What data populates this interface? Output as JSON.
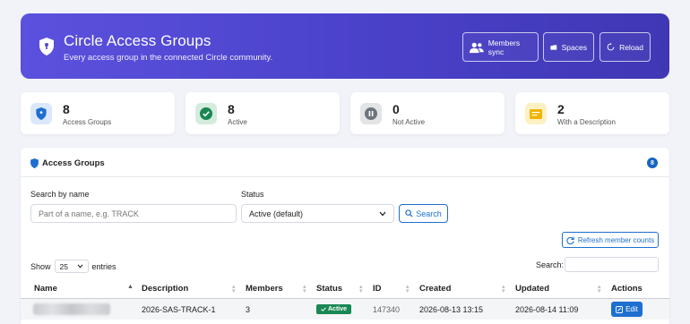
{
  "header": {
    "title": "Circle Access Groups",
    "subtitle": "Every access group in the connected Circle community.",
    "buttons": {
      "members_sync": "Members sync",
      "spaces": "Spaces",
      "reload": "Reload"
    }
  },
  "stats": [
    {
      "value": "8",
      "label": "Access Groups",
      "icon": "shield-icon",
      "color": "#1e6fd0"
    },
    {
      "value": "8",
      "label": "Active",
      "icon": "check-circle-icon",
      "color": "#198754"
    },
    {
      "value": "0",
      "label": "Not Active",
      "icon": "pause-circle-icon",
      "color": "#6c757d"
    },
    {
      "value": "2",
      "label": "With a Description",
      "icon": "description-icon",
      "color": "#f0b400"
    }
  ],
  "panel": {
    "title": "Access Groups",
    "count": "8",
    "search_label": "Search by name",
    "search_placeholder": "Part of a name, e.g. TRACK",
    "status_label": "Status",
    "status_value": "Active (default)",
    "search_button": "Search",
    "refresh_button": "Refresh member counts",
    "show_label": "Show",
    "entries_value": "25",
    "entries_label": "entries",
    "table_search_label": "Search:"
  },
  "table": {
    "columns": [
      "Name",
      "Description",
      "Members",
      "Status",
      "ID",
      "Created",
      "Updated",
      "Actions"
    ],
    "rows": [
      {
        "description": "2026-SAS-TRACK-1",
        "members": "3",
        "status": "Active",
        "id": "147340",
        "created": "2026-08-13 13:15",
        "updated": "2026-08-14 11:09",
        "action": "Edit"
      }
    ]
  }
}
